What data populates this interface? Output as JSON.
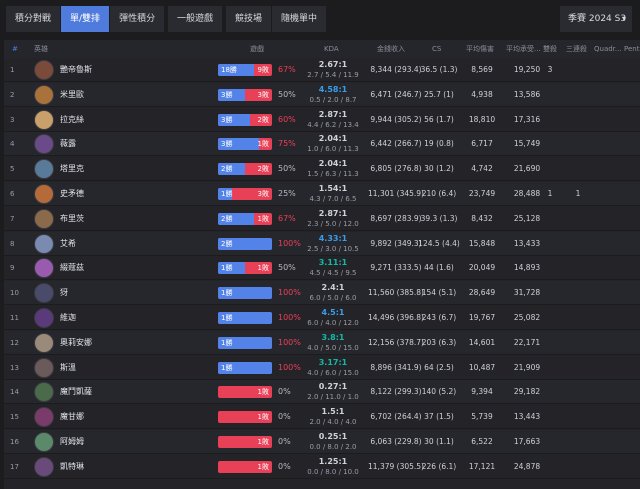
{
  "tabs": {
    "group1": [
      "積分對戰",
      "單/雙排",
      "彈性積分"
    ],
    "group2": [
      "一般遊戲"
    ],
    "group3": [
      "競技場",
      "隨機單中"
    ],
    "active": "單/雙排"
  },
  "season": {
    "label": "季賽 2024 S3",
    "chevron": "▾"
  },
  "columns": {
    "rank": "#",
    "champion": "英雄",
    "games": "遊戲",
    "kda": "KDA",
    "gold": "金錢收入",
    "cs": "CS",
    "dmg": "平均傷害",
    "taken": "平均承受...",
    "double": "雙殺",
    "triple": "三連殺",
    "quadra": "Quadr...",
    "penta": "Pent..."
  },
  "colors": {
    "accent": "#4f7bdd",
    "win": "#5383e8",
    "loss": "#e84057",
    "kda_blue": "#3b9cea",
    "kda_teal": "#14b8a6"
  },
  "rows": [
    {
      "rank": "1",
      "name": "艷帝魯斯",
      "wins": 18,
      "losses": 9,
      "win_label": "18勝",
      "loss_label": "9敗",
      "pct": "67%",
      "kda": "2.67:1",
      "kda_detail": "2.7 / 5.4 / 11.9",
      "gold": "8,344 (293.4)",
      "cs": "36.5 (1.3)",
      "dmg": "8,569",
      "taken": "19,250",
      "double": "3",
      "triple": "",
      "avatar": "#7a4a3a"
    },
    {
      "rank": "2",
      "name": "米里歐",
      "wins": 3,
      "losses": 3,
      "win_label": "3勝",
      "loss_label": "3敗",
      "pct": "50%",
      "kda": "4.58:1",
      "kda_detail": "0.5 / 2.0 / 8.7",
      "gold": "6,471 (246.7)",
      "cs": "25.7 (1)",
      "dmg": "4,938",
      "taken": "13,586",
      "double": "",
      "triple": "",
      "avatar": "#a8723a"
    },
    {
      "rank": "3",
      "name": "拉克絲",
      "wins": 3,
      "losses": 2,
      "win_label": "3勝",
      "loss_label": "2敗",
      "pct": "60%",
      "kda": "2.87:1",
      "kda_detail": "4.4 / 6.2 / 13.4",
      "gold": "9,944 (305.2)",
      "cs": "56 (1.7)",
      "dmg": "18,810",
      "taken": "17,316",
      "double": "",
      "triple": "",
      "avatar": "#c9a06a"
    },
    {
      "rank": "4",
      "name": "薇露",
      "wins": 3,
      "losses": 1,
      "win_label": "3勝",
      "loss_label": "1敗",
      "pct": "75%",
      "kda": "2.04:1",
      "kda_detail": "1.0 / 6.0 / 11.3",
      "gold": "6,442 (266.7)",
      "cs": "19 (0.8)",
      "dmg": "6,717",
      "taken": "15,749",
      "double": "",
      "triple": "",
      "avatar": "#6b4a8a"
    },
    {
      "rank": "5",
      "name": "塔里克",
      "wins": 2,
      "losses": 2,
      "win_label": "2勝",
      "loss_label": "2敗",
      "pct": "50%",
      "kda": "2.04:1",
      "kda_detail": "1.5 / 6.3 / 11.3",
      "gold": "6,805 (276.8)",
      "cs": "30 (1.2)",
      "dmg": "4,742",
      "taken": "21,690",
      "double": "",
      "triple": "",
      "avatar": "#5a7a9a"
    },
    {
      "rank": "6",
      "name": "史矛德",
      "wins": 1,
      "losses": 3,
      "win_label": "1勝",
      "loss_label": "3敗",
      "pct": "25%",
      "kda": "1.54:1",
      "kda_detail": "4.3 / 7.0 / 6.5",
      "gold": "11,301 (345.9)",
      "cs": "210 (6.4)",
      "dmg": "23,749",
      "taken": "28,488",
      "double": "1",
      "triple": "1",
      "avatar": "#b56a3a"
    },
    {
      "rank": "7",
      "name": "布里茨",
      "wins": 2,
      "losses": 1,
      "win_label": "2勝",
      "loss_label": "1敗",
      "pct": "67%",
      "kda": "2.87:1",
      "kda_detail": "2.3 / 5.0 / 12.0",
      "gold": "8,697 (283.9)",
      "cs": "39.3 (1.3)",
      "dmg": "8,432",
      "taken": "25,128",
      "double": "",
      "triple": "",
      "avatar": "#8a6a4a"
    },
    {
      "rank": "8",
      "name": "艾希",
      "wins": 2,
      "losses": 0,
      "win_label": "2勝",
      "loss_label": "",
      "pct": "100%",
      "kda": "4.33:1",
      "kda_detail": "2.5 / 3.0 / 10.5",
      "gold": "9,892 (349.3)",
      "cs": "124.5 (4.4)",
      "dmg": "15,848",
      "taken": "13,433",
      "double": "",
      "triple": "",
      "avatar": "#7a8ab0"
    },
    {
      "rank": "9",
      "name": "綴蔻茲",
      "wins": 1,
      "losses": 1,
      "win_label": "1勝",
      "loss_label": "1敗",
      "pct": "50%",
      "kda": "3.11:1",
      "kda_detail": "4.5 / 4.5 / 9.5",
      "gold": "9,271 (333.5)",
      "cs": "44 (1.6)",
      "dmg": "20,049",
      "taken": "14,893",
      "double": "",
      "triple": "",
      "avatar": "#9a5ab0"
    },
    {
      "rank": "10",
      "name": "犽",
      "wins": 1,
      "losses": 0,
      "win_label": "1勝",
      "loss_label": "",
      "pct": "100%",
      "kda": "2.4:1",
      "kda_detail": "6.0 / 5.0 / 6.0",
      "gold": "11,560 (385.8)",
      "cs": "154 (5.1)",
      "dmg": "28,649",
      "taken": "31,728",
      "double": "",
      "triple": "",
      "avatar": "#4a4a6a"
    },
    {
      "rank": "11",
      "name": "維迦",
      "wins": 1,
      "losses": 0,
      "win_label": "1勝",
      "loss_label": "",
      "pct": "100%",
      "kda": "4.5:1",
      "kda_detail": "6.0 / 4.0 / 12.0",
      "gold": "14,496 (396.8)",
      "cs": "243 (6.7)",
      "dmg": "19,767",
      "taken": "25,082",
      "double": "",
      "triple": "",
      "avatar": "#5a3a7a"
    },
    {
      "rank": "12",
      "name": "奧莉安娜",
      "wins": 1,
      "losses": 0,
      "win_label": "1勝",
      "loss_label": "",
      "pct": "100%",
      "kda": "3.8:1",
      "kda_detail": "4.0 / 5.0 / 15.0",
      "gold": "12,156 (378.7)",
      "cs": "203 (6.3)",
      "dmg": "14,601",
      "taken": "22,171",
      "double": "",
      "triple": "",
      "avatar": "#9a8a7a"
    },
    {
      "rank": "13",
      "name": "斯溫",
      "wins": 1,
      "losses": 0,
      "win_label": "1勝",
      "loss_label": "",
      "pct": "100%",
      "kda": "3.17:1",
      "kda_detail": "4.0 / 6.0 / 15.0",
      "gold": "8,896 (341.9)",
      "cs": "64 (2.5)",
      "dmg": "10,487",
      "taken": "21,909",
      "double": "",
      "triple": "",
      "avatar": "#6a5a5a"
    },
    {
      "rank": "14",
      "name": "魔鬥凱薩",
      "wins": 0,
      "losses": 1,
      "win_label": "",
      "loss_label": "1敗",
      "pct": "0%",
      "kda": "0.27:1",
      "kda_detail": "2.0 / 11.0 / 1.0",
      "gold": "8,122 (299.3)",
      "cs": "140 (5.2)",
      "dmg": "9,394",
      "taken": "29,182",
      "double": "",
      "triple": "",
      "avatar": "#4a6a4a"
    },
    {
      "rank": "15",
      "name": "魔甘娜",
      "wins": 0,
      "losses": 1,
      "win_label": "",
      "loss_label": "1敗",
      "pct": "0%",
      "kda": "1.5:1",
      "kda_detail": "2.0 / 4.0 / 4.0",
      "gold": "6,702 (264.4)",
      "cs": "37 (1.5)",
      "dmg": "5,739",
      "taken": "13,443",
      "double": "",
      "triple": "",
      "avatar": "#7a3a6a"
    },
    {
      "rank": "16",
      "name": "阿姆姆",
      "wins": 0,
      "losses": 1,
      "win_label": "",
      "loss_label": "1敗",
      "pct": "0%",
      "kda": "0.25:1",
      "kda_detail": "0.0 / 8.0 / 2.0",
      "gold": "6,063 (229.8)",
      "cs": "30 (1.1)",
      "dmg": "6,522",
      "taken": "17,663",
      "double": "",
      "triple": "",
      "avatar": "#5a8a6a"
    },
    {
      "rank": "17",
      "name": "凱特琳",
      "wins": 0,
      "losses": 1,
      "win_label": "",
      "loss_label": "1敗",
      "pct": "0%",
      "kda": "1.25:1",
      "kda_detail": "0.0 / 8.0 / 10.0",
      "gold": "11,379 (305.5)",
      "cs": "226 (6.1)",
      "dmg": "17,121",
      "taken": "24,878",
      "double": "",
      "triple": "",
      "avatar": "#6a4a7a"
    }
  ]
}
